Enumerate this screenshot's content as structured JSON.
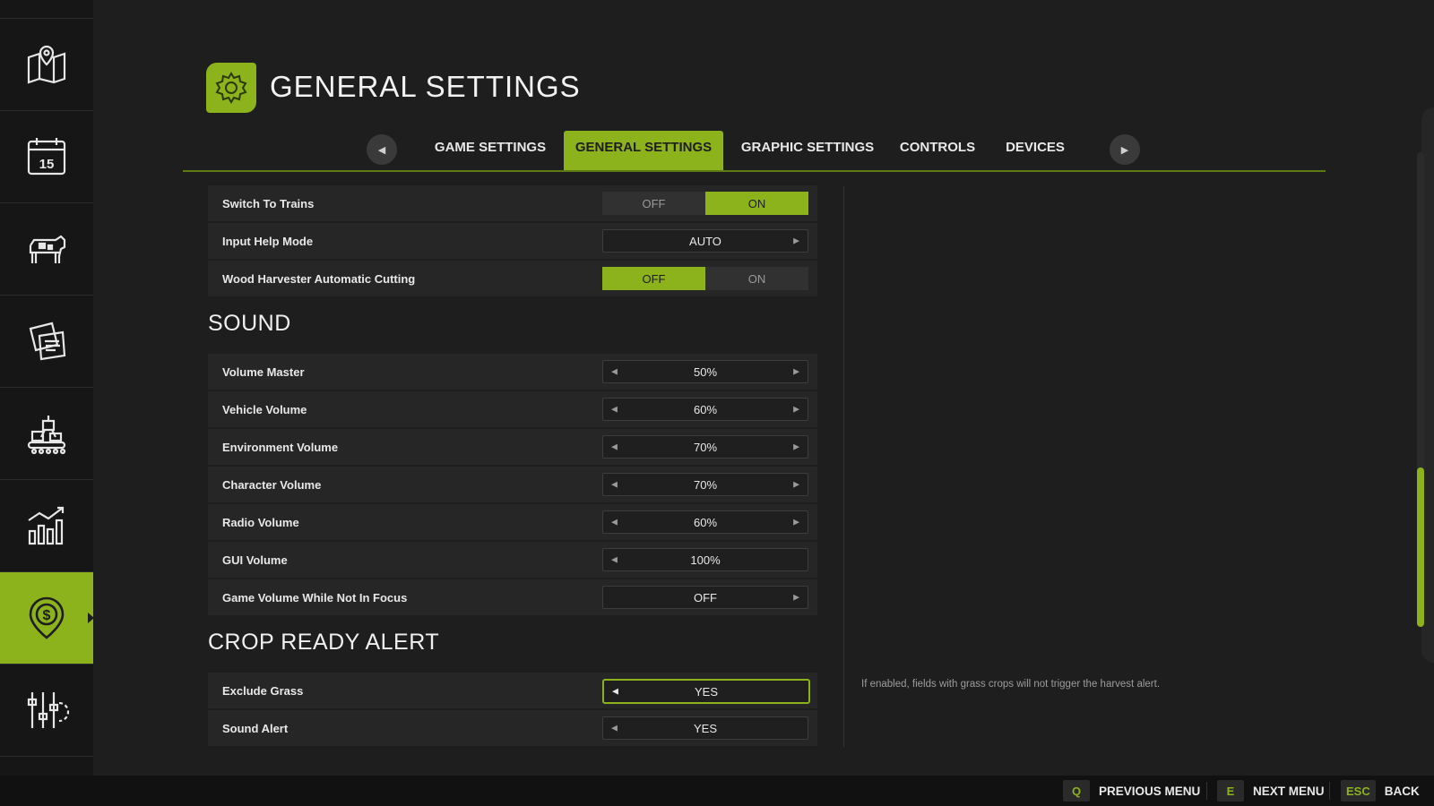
{
  "sidebar": {
    "items": [
      {
        "icon": "map-icon",
        "active": false
      },
      {
        "icon": "calendar-icon",
        "active": false,
        "calendar_day": "15"
      },
      {
        "icon": "animals-icon",
        "active": false
      },
      {
        "icon": "contracts-icon",
        "active": false
      },
      {
        "icon": "production-icon",
        "active": false
      },
      {
        "icon": "statistics-icon",
        "active": false
      },
      {
        "icon": "finance-icon",
        "active": true
      },
      {
        "icon": "settings-sliders-icon",
        "active": false
      }
    ]
  },
  "header": {
    "title": "GENERAL SETTINGS",
    "icon": "gear-icon"
  },
  "tabs": {
    "items": [
      {
        "label": "GAME SETTINGS",
        "active": false
      },
      {
        "label": "GENERAL SETTINGS",
        "active": true
      },
      {
        "label": "GRAPHIC SETTINGS",
        "active": false
      },
      {
        "label": "CONTROLS",
        "active": false
      },
      {
        "label": "DEVICES",
        "active": false
      }
    ]
  },
  "settings": {
    "switch_to_trains": {
      "label": "Switch To Trains",
      "off": "OFF",
      "on": "ON",
      "value": "ON"
    },
    "input_help_mode": {
      "label": "Input Help Mode",
      "value": "AUTO"
    },
    "wood_harvester": {
      "label": "Wood Harvester Automatic Cutting",
      "off": "OFF",
      "on": "ON",
      "value": "OFF"
    }
  },
  "sound": {
    "title": "SOUND",
    "volume_master": {
      "label": "Volume Master",
      "value": "50%"
    },
    "vehicle_volume": {
      "label": "Vehicle Volume",
      "value": "60%"
    },
    "environment_volume": {
      "label": "Environment Volume",
      "value": "70%"
    },
    "character_volume": {
      "label": "Character Volume",
      "value": "70%"
    },
    "radio_volume": {
      "label": "Radio Volume",
      "value": "60%"
    },
    "gui_volume": {
      "label": "GUI Volume",
      "value": "100%"
    },
    "game_volume_unfocused": {
      "label": "Game Volume While Not In Focus",
      "value": "OFF"
    }
  },
  "crop_alert": {
    "title": "CROP READY ALERT",
    "exclude_grass": {
      "label": "Exclude Grass",
      "value": "YES"
    },
    "sound_alert": {
      "label": "Sound Alert",
      "value": "YES"
    }
  },
  "description": "If enabled, fields with grass crops will not trigger the harvest alert.",
  "footer": {
    "prev": {
      "key": "Q",
      "label": "PREVIOUS MENU"
    },
    "next": {
      "key": "E",
      "label": "NEXT MENU"
    },
    "back": {
      "key": "ESC",
      "label": "BACK"
    }
  },
  "colors": {
    "accent": "#8cb21c",
    "background": "#1e1e1e",
    "sidebar": "#161616",
    "row": "#262626"
  }
}
